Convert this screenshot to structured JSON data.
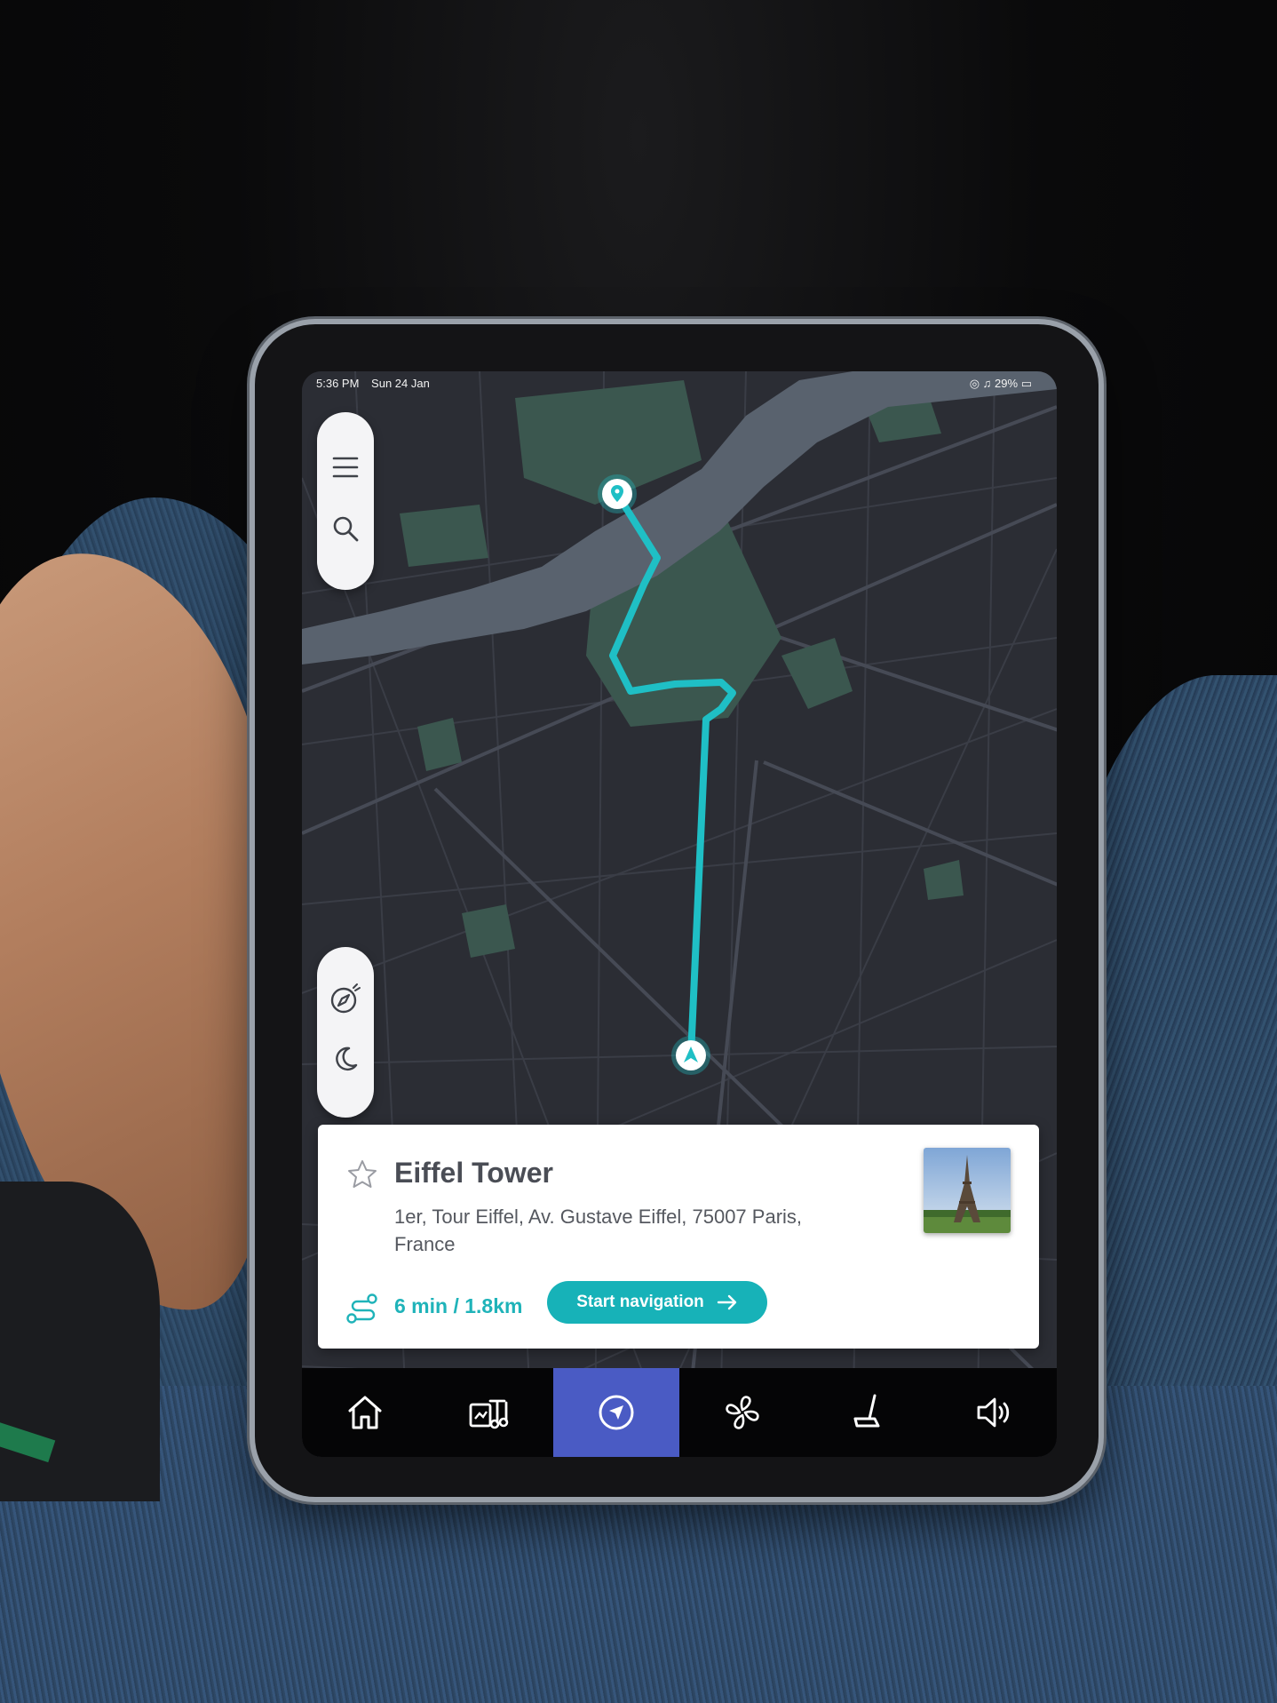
{
  "status_bar": {
    "time": "5:36 PM",
    "date": "Sun 24 Jan",
    "battery": "29%"
  },
  "map_controls": {
    "top": [
      "menu",
      "search"
    ],
    "bottom": [
      "compass",
      "night-mode"
    ]
  },
  "place": {
    "name": "Eiffel Tower",
    "address": "1er, Tour Eiffel, Av. Gustave Eiffel, 75007 Paris, France",
    "eta": "6 min / 1.8km",
    "start_label": "Start navigation"
  },
  "bottom_nav": {
    "items": [
      "home",
      "media",
      "navigation",
      "climate",
      "seat",
      "volume"
    ],
    "active": "navigation"
  },
  "colors": {
    "route": "#1fbfc5",
    "accent": "#17b2b8",
    "active_tab": "#4a5bc4"
  }
}
